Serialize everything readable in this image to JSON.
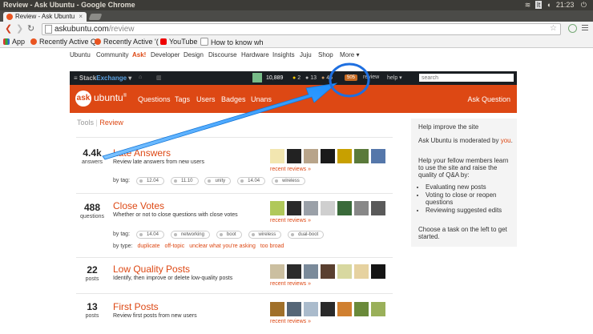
{
  "os": {
    "window_title": "Review - Ask Ubuntu - Google Chrome",
    "clock": "21:23"
  },
  "browser": {
    "tab_active": "Review - Ask Ubuntu",
    "tab_close": "×",
    "url_host": "askubuntu.com",
    "url_path": "/review",
    "bookmarks": [
      "App",
      "Recently Active Q",
      "Recently Active '(",
      "YouTube",
      "How to know wh"
    ]
  },
  "ubuntu_nav": [
    "Ubuntu",
    "Community",
    "Ask!",
    "Developer",
    "Design",
    "Discourse",
    "Hardware",
    "Insights",
    "Juju",
    "Shop",
    "More"
  ],
  "se_bar": {
    "brand_a": "Stack",
    "brand_b": "Exchange",
    "rep": "10,889",
    "gold": "2",
    "silver": "13",
    "bronze": "45",
    "review_count": "505",
    "links": [
      "review",
      "help"
    ],
    "search_placeholder": "search"
  },
  "site_header": {
    "logo": "ask",
    "site_name": "ubuntu",
    "nav": [
      "Questions",
      "Tags",
      "Users",
      "Badges",
      "Unans"
    ],
    "ask_button": "Ask Question"
  },
  "breadcrumb": {
    "parent": "Tools",
    "sep": "|",
    "current": "Review"
  },
  "queues": [
    {
      "count": "4.4k",
      "unit": "answers",
      "title": "Late Answers",
      "desc": "Review late answers from new users",
      "by_tag_label": "by tag:",
      "tags": [
        "12.04",
        "11.10",
        "unity",
        "14.04",
        "wireless"
      ],
      "by_type_label": "",
      "types": [],
      "recent": "recent reviews »",
      "avatar_colors": [
        "#f2e6b0",
        "#222222",
        "#b8a48a",
        "#1a1a1a",
        "#c8a000",
        "#5a7a3a",
        "#5577aa"
      ]
    },
    {
      "count": "488",
      "unit": "questions",
      "title": "Close Votes",
      "desc": "Whether or not to close questions with close votes",
      "by_tag_label": "by tag:",
      "tags": [
        "14.04",
        "networking",
        "boot",
        "wireless",
        "dual-boot"
      ],
      "by_type_label": "by type:",
      "types": [
        "duplicate",
        "off-topic",
        "unclear what you're asking",
        "too broad"
      ],
      "recent": "recent reviews »",
      "avatar_colors": [
        "#b0c85a",
        "#2a2a2a",
        "#9aa0a8",
        "#cfcfcf",
        "#3a6a3a",
        "#888888",
        "#5a5a5a"
      ]
    },
    {
      "count": "22",
      "unit": "posts",
      "title": "Low Quality Posts",
      "desc": "Identify, then improve or delete low-quality posts",
      "by_tag_label": "",
      "tags": [],
      "by_type_label": "",
      "types": [],
      "recent": "recent reviews »",
      "avatar_colors": [
        "#cbbfa0",
        "#2b2b2b",
        "#7a8a9a",
        "#5a4030",
        "#d8d8a0",
        "#e6d2a0",
        "#151515"
      ]
    },
    {
      "count": "13",
      "unit": "posts",
      "title": "First Posts",
      "desc": "Review first posts from new users",
      "by_tag_label": "",
      "tags": [],
      "by_type_label": "",
      "types": [],
      "recent": "recent reviews »",
      "avatar_colors": [
        "#a0702a",
        "#556677",
        "#aabbcc",
        "#2a2a2a",
        "#d08030",
        "#6a8a3a",
        "#9ab05a"
      ]
    }
  ],
  "sidebar": {
    "title": "Help improve the site",
    "moderated_pre": "Ask Ubuntu is moderated by",
    "moderated_you": "you",
    "help_text": "Help your fellow members learn to use the site and raise the quality of Q&A by:",
    "bullets": [
      "Evaluating new posts",
      "Voting to close or reopen questions",
      "Reviewing suggested edits"
    ],
    "cta": "Choose a task on the left to get started."
  },
  "colors": {
    "accent": "#dd4814",
    "annotation": "#1e90ff"
  }
}
